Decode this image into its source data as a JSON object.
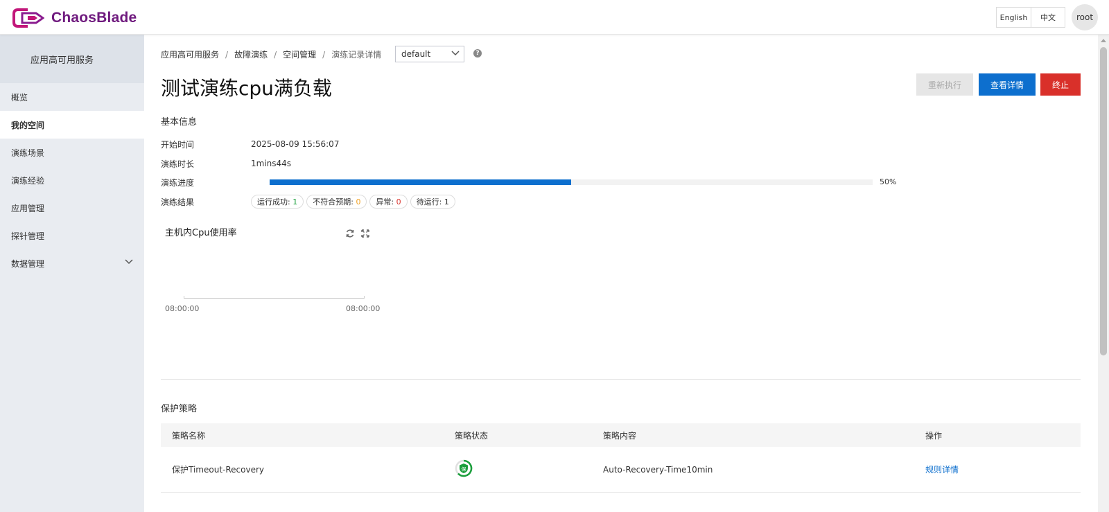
{
  "app": {
    "logo_text": "ChaosBlade",
    "brand_color": "#6f1a7e"
  },
  "header": {
    "lang_en": "English",
    "lang_zh": "中文",
    "user": "root"
  },
  "sidebar": {
    "title": "应用高可用服务",
    "items": [
      {
        "label": "概览"
      },
      {
        "label": "我的空间",
        "active": true
      },
      {
        "label": "演练场景"
      },
      {
        "label": "演练经验"
      },
      {
        "label": "应用管理"
      },
      {
        "label": "探针管理"
      },
      {
        "label": "数据管理",
        "icon": "chevron-down-icon"
      }
    ]
  },
  "breadcrumb": [
    "应用高可用服务",
    "故障演练",
    "空间管理",
    "演练记录详情"
  ],
  "namespace_select": {
    "value": "default"
  },
  "page": {
    "title": "测试演练cpu满负载",
    "buttons": {
      "rerun": "重新执行",
      "detail": "查看详情",
      "stop": "终止"
    }
  },
  "basic_info": {
    "section_title": "基本信息",
    "start_time_label": "开始时间",
    "start_time": "2025-08-09 15:56:07",
    "duration_label": "演练时长",
    "duration": "1mins44s",
    "progress_label": "演练进度",
    "progress_value": 0.5,
    "progress_text": "50%",
    "result_label": "演练结果",
    "results": [
      {
        "label": "运行成功:",
        "count": "1",
        "color": "#1a9e3b"
      },
      {
        "label": "不符合预期:",
        "count": "0",
        "color": "#f0a020"
      },
      {
        "label": "异常:",
        "count": "0",
        "color": "#d9302a"
      },
      {
        "label": "待运行:",
        "count": "1",
        "color": "#333333"
      }
    ]
  },
  "chart": {
    "title": "主机内Cpu使用率",
    "icons": [
      "refresh-icon",
      "fullscreen-icon"
    ],
    "x_ticks": [
      "08:00:00",
      "08:00:00"
    ]
  },
  "protection": {
    "section_title": "保护策略",
    "columns": [
      "策略名称",
      "策略状态",
      "策略内容",
      "操作"
    ],
    "rows": [
      {
        "name": "保护Timeout-Recovery",
        "status_icon": "shield-status-icon",
        "status_char": "保",
        "content": "Auto-Recovery-Time10min",
        "action": "规则详情"
      }
    ]
  }
}
